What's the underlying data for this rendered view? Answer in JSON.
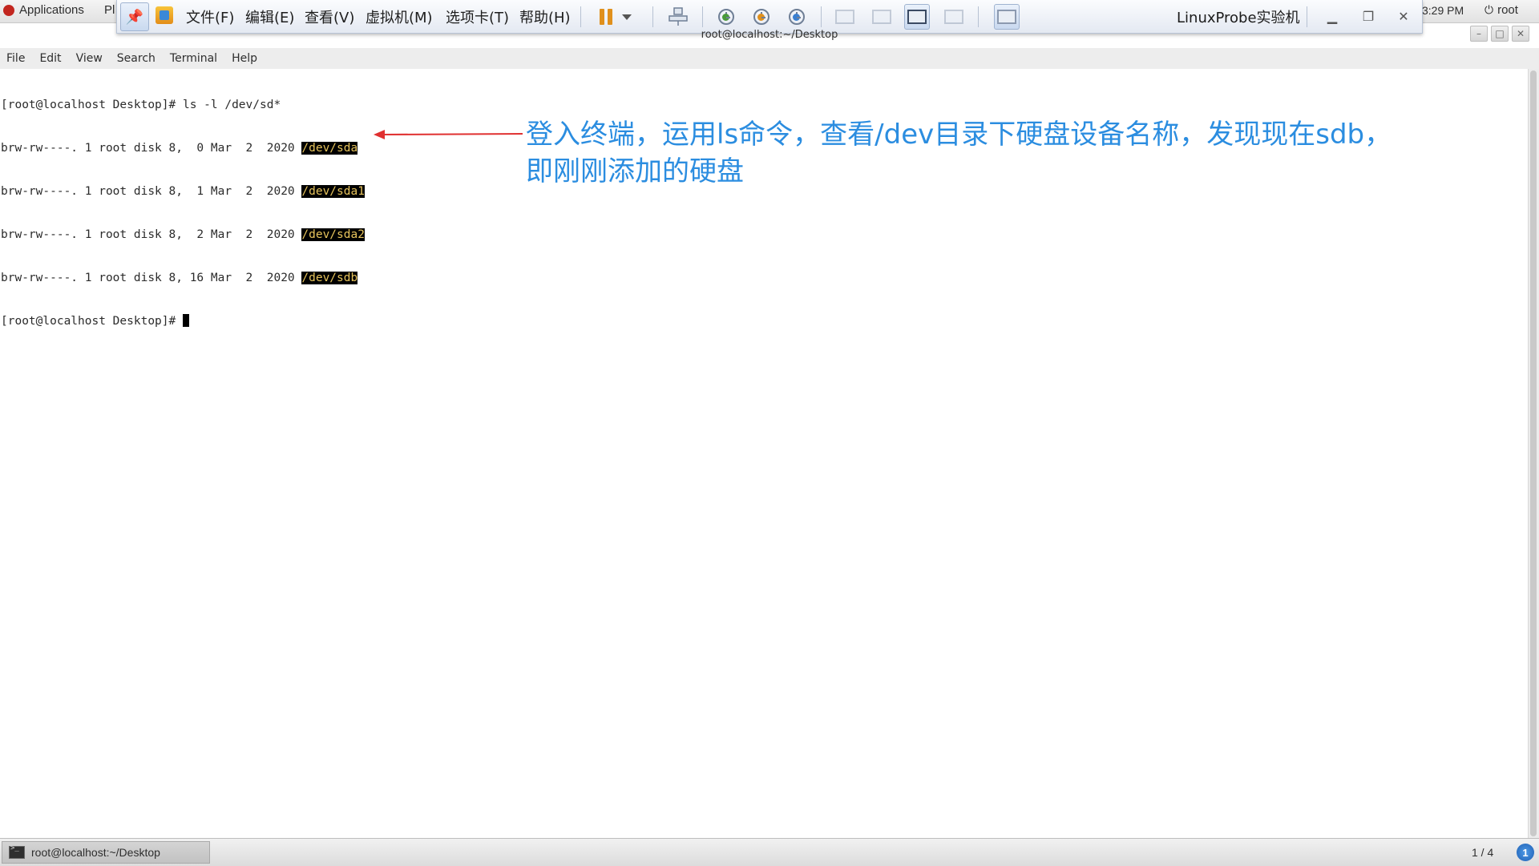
{
  "topbar": {
    "applications_label": "Applications",
    "places_label": "Pl",
    "clock": "3:29 PM",
    "user": "root"
  },
  "vmware": {
    "menus": [
      "文件(F)",
      "编辑(E)",
      "查看(V)",
      "虚拟机(M)",
      "选项卡(T)",
      "帮助(H)"
    ],
    "title": "LinuxProbe实验机"
  },
  "terminal": {
    "title": "root@localhost:~/Desktop",
    "menu": [
      "File",
      "Edit",
      "View",
      "Search",
      "Terminal",
      "Help"
    ],
    "lines": [
      {
        "text": "[root@localhost Desktop]# ls -l /dev/sd*",
        "highlight": ""
      },
      {
        "text": "brw-rw----. 1 root disk 8,  0 Mar  2  2020 ",
        "highlight": "/dev/sda"
      },
      {
        "text": "brw-rw----. 1 root disk 8,  1 Mar  2  2020 ",
        "highlight": "/dev/sda1"
      },
      {
        "text": "brw-rw----. 1 root disk 8,  2 Mar  2  2020 ",
        "highlight": "/dev/sda2"
      },
      {
        "text": "brw-rw----. 1 root disk 8, 16 Mar  2  2020 ",
        "highlight": "/dev/sdb"
      },
      {
        "text": "[root@localhost Desktop]# ",
        "highlight": "",
        "cursor": true
      }
    ]
  },
  "annotation": {
    "line1": "登入终端，运用ls命令，查看/dev目录下硬盘设备名称，发现现在sdb，",
    "line2": "即刚刚添加的硬盘",
    "color": "#2b8de0",
    "arrow_color": "#e03030"
  },
  "taskbar": {
    "task_label": "root@localhost:~/Desktop",
    "workspace": "1 / 4",
    "notification_count": "1"
  }
}
